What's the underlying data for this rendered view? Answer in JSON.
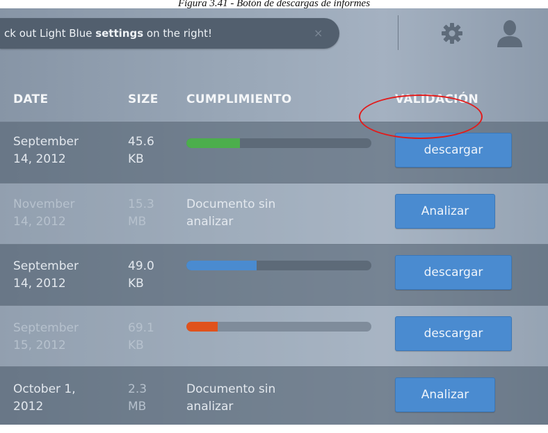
{
  "caption": "Figura 3.41 - Botón de descargas de informes",
  "notice": {
    "prefix": "ck out Light Blue ",
    "bold": "settings",
    "suffix": " on the right!",
    "close": "×"
  },
  "toolbar": {
    "settings_icon": "gear-icon",
    "user_icon": "user-icon"
  },
  "table": {
    "headers": {
      "date": "DATE",
      "size": "SIZE",
      "compliance": "CUMPLIMIENTO",
      "validation": "VALIDACIÓN"
    },
    "rows": [
      {
        "date_line1": "September",
        "date_line2": "14, 2012",
        "size_line1": "45.6",
        "size_line2": "KB",
        "status_line1": "",
        "status_line2": "",
        "progress": 0.29,
        "progress_color": "#4cae4c",
        "action": "descargar"
      },
      {
        "date_line1": "November",
        "date_line2": "14, 2012",
        "size_line1": "15.3",
        "size_line2": "MB",
        "status_line1": "Documento sin",
        "status_line2": "analizar",
        "progress": null,
        "progress_color": "",
        "action": "Analizar"
      },
      {
        "date_line1": "September",
        "date_line2": "14, 2012",
        "size_line1": "49.0",
        "size_line2": "KB",
        "status_line1": "",
        "status_line2": "",
        "progress": 0.38,
        "progress_color": "#4a8bd0",
        "action": "descargar"
      },
      {
        "date_line1": "September",
        "date_line2": "15, 2012",
        "size_line1": "69.1",
        "size_line2": "KB",
        "status_line1": "",
        "status_line2": "",
        "progress": 0.17,
        "progress_color": "#e0521c",
        "action": "descargar"
      },
      {
        "date_line1": "October 1,",
        "date_line2": "2012",
        "size_line1": "2.3",
        "size_line2": "MB",
        "status_line1": "Documento sin",
        "status_line2": "analizar",
        "progress": null,
        "progress_color": "",
        "action": "Analizar"
      }
    ]
  },
  "annotation": {
    "color": "#e21b1b",
    "shape": "ellipse"
  },
  "colors": {
    "accent": "#4a8bd0",
    "background": "#9aa8b8",
    "notice_bg": "#525f6e"
  }
}
